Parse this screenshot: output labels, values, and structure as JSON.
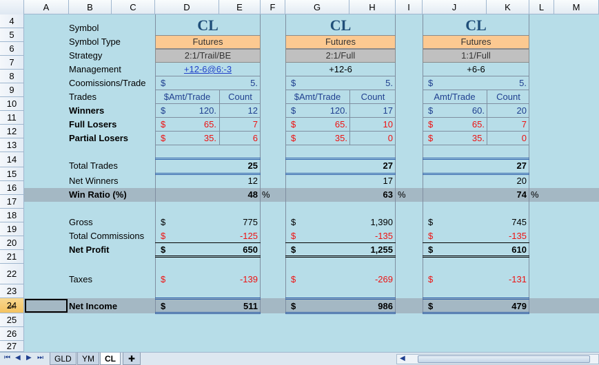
{
  "columns": [
    "A",
    "B",
    "C",
    "D",
    "E",
    "F",
    "G",
    "H",
    "I",
    "J",
    "K",
    "L",
    "M"
  ],
  "rows": [
    "4",
    "5",
    "6",
    "7",
    "8",
    "9",
    "10",
    "11",
    "12",
    "13",
    "14",
    "15",
    "16",
    "17",
    "18",
    "19",
    "20",
    "21",
    "22",
    "23",
    "24",
    "25",
    "26",
    "27"
  ],
  "labels": {
    "symbol": "Symbol",
    "symbol_type": "Symbol Type",
    "strategy": "Strategy",
    "management": "Management",
    "commissions": "Coomissions/Trade",
    "trades": "Trades",
    "winners": "Winners",
    "full_losers": "Full Losers",
    "partial_losers": "Partial Losers",
    "total_trades": "Total Trades",
    "net_winners": "Net Winners",
    "win_ratio": "Win Ratio (%)",
    "gross": "Gross",
    "total_commissions": "Total Commissions",
    "net_profit": "Net Profit",
    "taxes": "Taxes",
    "net_income": "Net Income"
  },
  "dollar": "$",
  "percent": "%",
  "blocks": [
    {
      "symbol": "CL",
      "symbol_type": "Futures",
      "strategy": "2:1/Trail/BE",
      "management": "+12-6@6:-3",
      "commission": "5.",
      "amt_header": "$Amt/Trade",
      "count_header": "Count",
      "winners_amt": "120.",
      "winners_count": "12",
      "full_amt": "65.",
      "full_count": "7",
      "partial_amt": "35.",
      "partial_count": "6",
      "total_trades": "25",
      "net_winners": "12",
      "win_ratio": "48",
      "gross": "775",
      "total_commissions": "-125",
      "net_profit": "650",
      "taxes": "-139",
      "net_income": "511"
    },
    {
      "symbol": "CL",
      "symbol_type": "Futures",
      "strategy": "2:1/Full",
      "management": "+12-6",
      "commission": "5.",
      "amt_header": "$Amt/Trade",
      "count_header": "Count",
      "winners_amt": "120.",
      "winners_count": "17",
      "full_amt": "65.",
      "full_count": "10",
      "partial_amt": "35.",
      "partial_count": "0",
      "total_trades": "27",
      "net_winners": "17",
      "win_ratio": "63",
      "gross": "1,390",
      "total_commissions": "-135",
      "net_profit": "1,255",
      "taxes": "-269",
      "net_income": "986"
    },
    {
      "symbol": "CL",
      "symbol_type": "Futures",
      "strategy": "1:1/Full",
      "management": "+6-6",
      "commission": "5.",
      "amt_header": "Amt/Trade",
      "count_header": "Count",
      "winners_amt": "60.",
      "winners_count": "20",
      "full_amt": "65.",
      "full_count": "7",
      "partial_amt": "35.",
      "partial_count": "0",
      "total_trades": "27",
      "net_winners": "20",
      "win_ratio": "74",
      "gross": "745",
      "total_commissions": "-135",
      "net_profit": "610",
      "taxes": "-131",
      "net_income": "479"
    }
  ],
  "tabs": [
    "GLD",
    "YM",
    "CL"
  ],
  "colors": {
    "background": "#b7dde8",
    "orange": "#fcc991",
    "gray": "#c0c0c0",
    "band": "#a4b8c4",
    "red": "#ee1111",
    "blue": "#1f3f8f"
  }
}
